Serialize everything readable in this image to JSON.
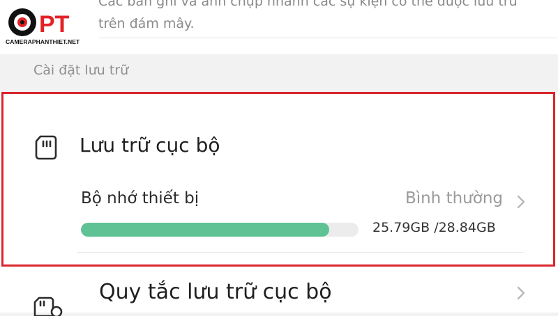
{
  "watermark": {
    "brand_letters": "PT",
    "caption": "CAMERAPHANTHIET.NET"
  },
  "cloud_section": {
    "description": "Các bản ghi và ảnh chụp nhanh các sự kiện có thể được lưu trữ trên đám mây."
  },
  "storage_settings": {
    "section_title": "Cài đặt lưu trữ",
    "local_storage": {
      "title": "Lưu trữ cục bộ",
      "icon": "sd-card-icon",
      "device_memory": {
        "label": "Bộ nhớ thiết bị",
        "status": "Bình thường",
        "capacity_text": "25.79GB /28.84GB",
        "used_fraction": 0.894
      }
    },
    "local_rules": {
      "title": "Quy tắc lưu trữ cục bộ",
      "icon": "sd-card-settings-icon"
    }
  },
  "colors": {
    "progress_fill": "#5fc294",
    "highlight_border": "#d9252c",
    "logo_red": "#e32228"
  }
}
